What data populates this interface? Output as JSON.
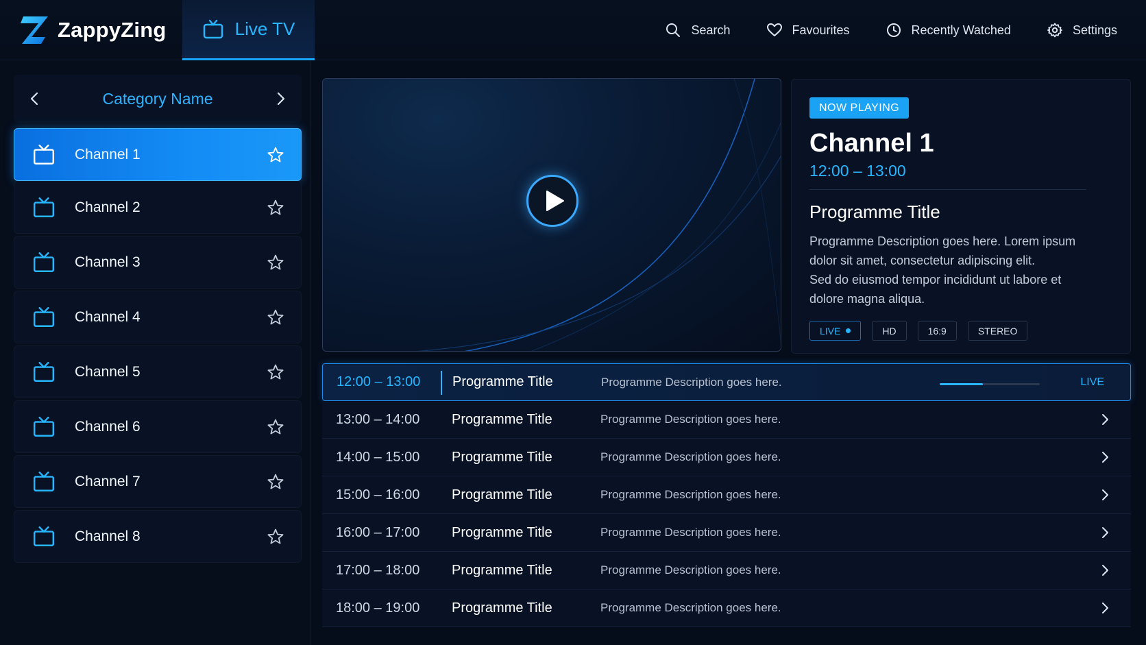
{
  "app": {
    "name": "ZappyZing",
    "active_tab": "Live TV",
    "accent_color": "#1aa7ff"
  },
  "nav": {
    "items": [
      {
        "label": "Search",
        "icon": "search-icon"
      },
      {
        "label": "Favourites",
        "icon": "heart-icon"
      },
      {
        "label": "Recently Watched",
        "icon": "clock-icon"
      },
      {
        "label": "Settings",
        "icon": "gear-icon"
      }
    ]
  },
  "sidebar": {
    "category": "Category Name",
    "channels": [
      {
        "name": "Channel 1",
        "selected": true
      },
      {
        "name": "Channel 2",
        "selected": false
      },
      {
        "name": "Channel 3",
        "selected": false
      },
      {
        "name": "Channel 4",
        "selected": false
      },
      {
        "name": "Channel 5",
        "selected": false
      },
      {
        "name": "Channel 6",
        "selected": false
      },
      {
        "name": "Channel 7",
        "selected": false
      },
      {
        "name": "Channel 8",
        "selected": false
      }
    ]
  },
  "now_playing": {
    "badge": "NOW PLAYING",
    "channel": "Channel 1",
    "time": "12:00 – 13:00",
    "title": "Programme Title",
    "description_lines": [
      "Programme Description goes here. Lorem ipsum",
      "dolor sit amet, consectetur adipiscing elit.",
      "Sed do eiusmod tempor incididunt ut labore et",
      "dolore magna aliqua."
    ],
    "tags": [
      "LIVE",
      "HD",
      "16:9",
      "STEREO"
    ]
  },
  "schedule": {
    "live_label": "LIVE",
    "live_progress": 0.43,
    "rows": [
      {
        "time": "12:00 – 13:00",
        "title": "Programme Title",
        "description": "Programme Description goes here.",
        "live": true
      },
      {
        "time": "13:00 – 14:00",
        "title": "Programme Title",
        "description": "Programme Description goes here.",
        "live": false
      },
      {
        "time": "14:00 – 15:00",
        "title": "Programme Title",
        "description": "Programme Description goes here.",
        "live": false
      },
      {
        "time": "15:00 – 16:00",
        "title": "Programme Title",
        "description": "Programme Description goes here.",
        "live": false
      },
      {
        "time": "16:00 – 17:00",
        "title": "Programme Title",
        "description": "Programme Description goes here.",
        "live": false
      },
      {
        "time": "17:00 – 18:00",
        "title": "Programme Title",
        "description": "Programme Description goes here.",
        "live": false
      },
      {
        "time": "18:00 – 19:00",
        "title": "Programme Title",
        "description": "Programme Description goes here.",
        "live": false
      }
    ]
  }
}
